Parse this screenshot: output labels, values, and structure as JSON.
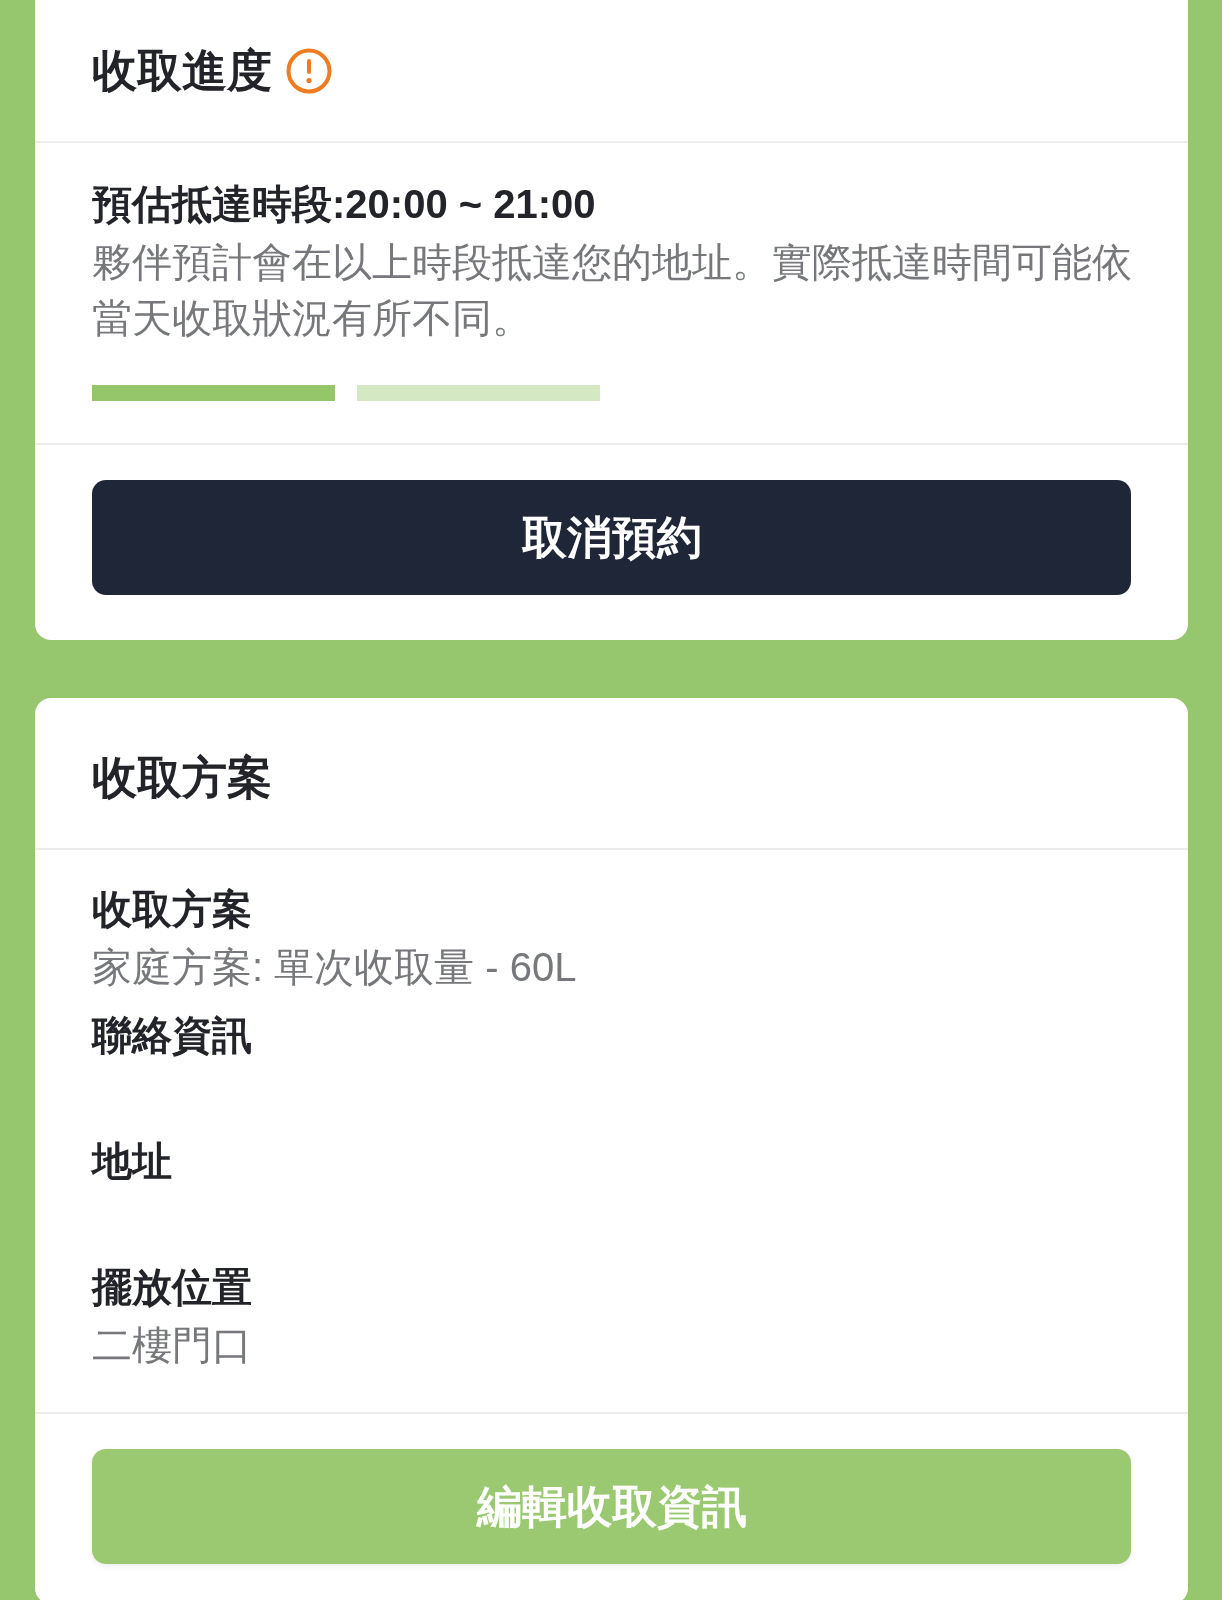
{
  "progress_card": {
    "title": "收取進度",
    "eta": "預估抵達時段:20:00 ~ 21:00",
    "description": "夥伴預計會在以上時段抵達您的地址。實際抵達時間可能依當天收取狀況有所不同。",
    "steps": [
      {
        "completed": true
      },
      {
        "completed": false
      }
    ],
    "button": "取消預約"
  },
  "plan_card": {
    "title": "收取方案",
    "fields": [
      {
        "label": "收取方案",
        "value": "家庭方案: 單次收取量 - 60L"
      },
      {
        "label": "聯絡資訊"
      },
      {
        "label": "地址"
      },
      {
        "label": "擺放位置",
        "value": "二樓門口"
      }
    ],
    "button": "編輯收取資訊"
  }
}
